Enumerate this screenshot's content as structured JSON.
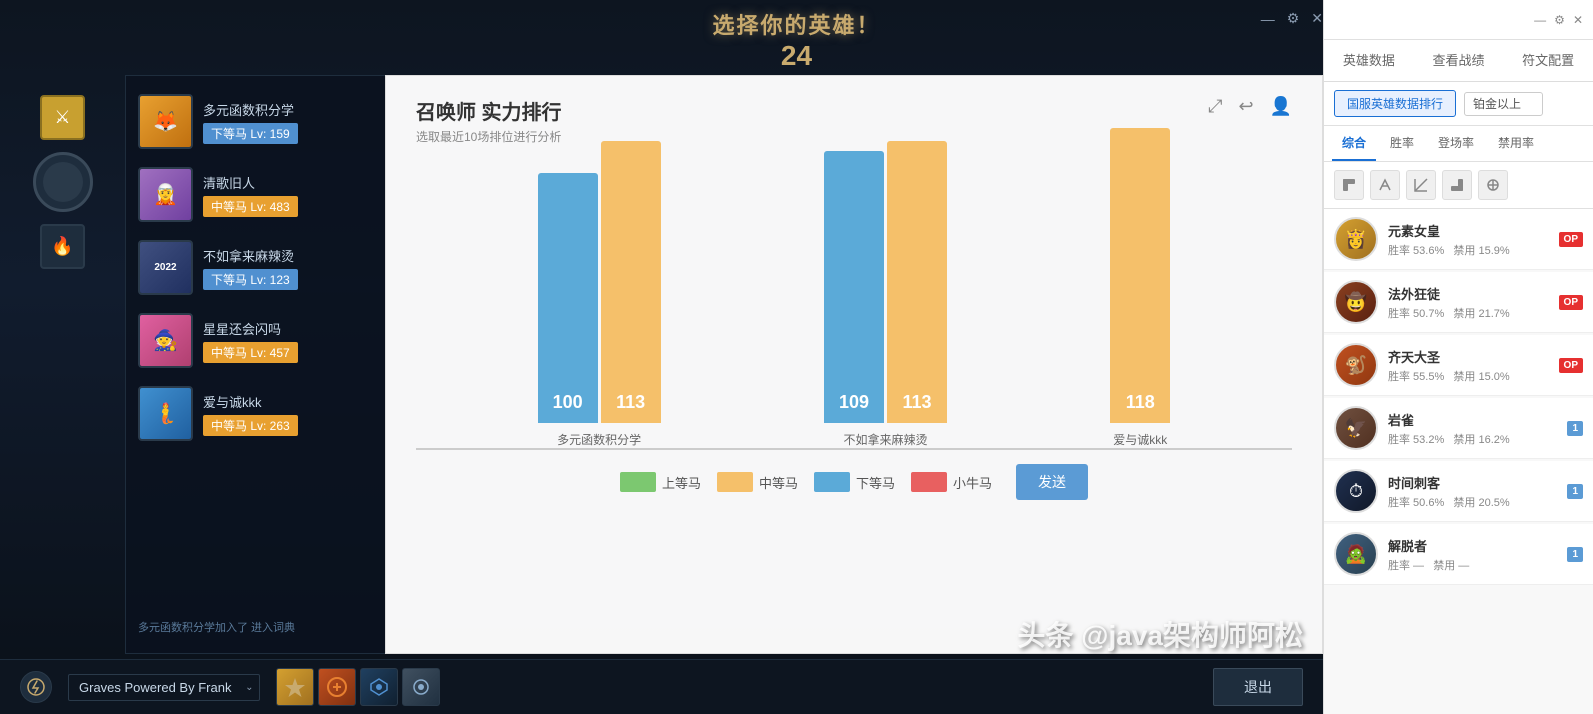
{
  "window": {
    "title": "选择你的英雄！",
    "subtitle": "24",
    "controls": {
      "minimize": "—",
      "settings": "⚙",
      "close": "✕"
    }
  },
  "players": [
    {
      "name": "多元函数积分学",
      "rank": "下等马 Lv: 159",
      "rankClass": "rank-low",
      "avClass": "av-fox"
    },
    {
      "name": "清歌旧人",
      "rank": "中等马 Lv: 483",
      "rankClass": "rank-mid",
      "avClass": "av-purple"
    },
    {
      "name": "不如拿来麻辣烫",
      "rank": "下等马 Lv: 123",
      "rankClass": "rank-low",
      "avClass": "av-dark"
    },
    {
      "name": "星星还会闪吗",
      "rank": "中等马 Lv: 457",
      "rankClass": "rank-mid",
      "avClass": "av-pink"
    },
    {
      "name": "爱与诚kkk",
      "rank": "中等马 Lv: 263",
      "rankClass": "rank-mid",
      "avClass": "av-blue"
    }
  ],
  "chart": {
    "title": "召唤师 实力排行",
    "subtitle": "选取最近10场排位进行分析",
    "bars": [
      {
        "group": "多元函数积分学",
        "values": [
          {
            "val": 100,
            "type": "blue"
          },
          {
            "val": 113,
            "type": "orange"
          }
        ]
      },
      {
        "group": "不如拿来麻辣烫",
        "values": [
          {
            "val": 109,
            "type": "blue"
          },
          {
            "val": 113,
            "type": "orange"
          }
        ]
      },
      {
        "group": "爱与诚kkk",
        "values": [
          {
            "val": 118,
            "type": "orange"
          }
        ]
      }
    ],
    "legend": [
      {
        "label": "上等马",
        "colorClass": "legend-green"
      },
      {
        "label": "中等马",
        "colorClass": "legend-orange"
      },
      {
        "label": "下等马",
        "colorClass": "legend-blue"
      },
      {
        "label": "小牛马",
        "colorClass": "legend-red"
      }
    ],
    "send_label": "发送"
  },
  "bottom_bar": {
    "graves_label": "Graves Powered By Frank",
    "exit_label": "退出"
  },
  "right_panel": {
    "tabs": [
      {
        "label": "英雄数据",
        "active": false
      },
      {
        "label": "查看战绩",
        "active": false
      },
      {
        "label": "符文配置",
        "active": false
      }
    ],
    "filter_label": "国服英雄数据排行",
    "tier_filter": "铂金以上",
    "sub_tabs": [
      {
        "label": "综合",
        "active": true
      },
      {
        "label": "胜率",
        "active": false
      },
      {
        "label": "登场率",
        "active": false
      },
      {
        "label": "禁用率",
        "active": false
      }
    ],
    "roles": [
      "top",
      "jungle",
      "mid",
      "bot",
      "support"
    ],
    "heroes": [
      {
        "name": "元素女皇",
        "winrate": "胜率 53.6%",
        "banrate": "禁用 15.9%",
        "badge": "OP",
        "badgeType": "op",
        "avClass": "av-elem"
      },
      {
        "name": "法外狂徒",
        "winrate": "胜率 50.7%",
        "banrate": "禁用 21.7%",
        "badge": "OP",
        "badgeType": "op",
        "avClass": "av-outlaw"
      },
      {
        "name": "齐天大圣",
        "winrate": "胜率 55.5%",
        "banrate": "禁用 15.0%",
        "badge": "OP",
        "badgeType": "op",
        "avClass": "av-monkey"
      },
      {
        "name": "岩雀",
        "winrate": "胜率 53.2%",
        "banrate": "禁用 16.2%",
        "badge": "1",
        "badgeType": "tier",
        "avClass": "av-rock"
      },
      {
        "name": "时间刺客",
        "winrate": "胜率 50.6%",
        "banrate": "禁用 20.5%",
        "badge": "1",
        "badgeType": "tier",
        "avClass": "av-time"
      },
      {
        "name": "解脱者",
        "winrate": "胜率 —",
        "banrate": "禁用 —",
        "badge": "1",
        "badgeType": "tier",
        "avClass": "av-escape"
      }
    ]
  }
}
